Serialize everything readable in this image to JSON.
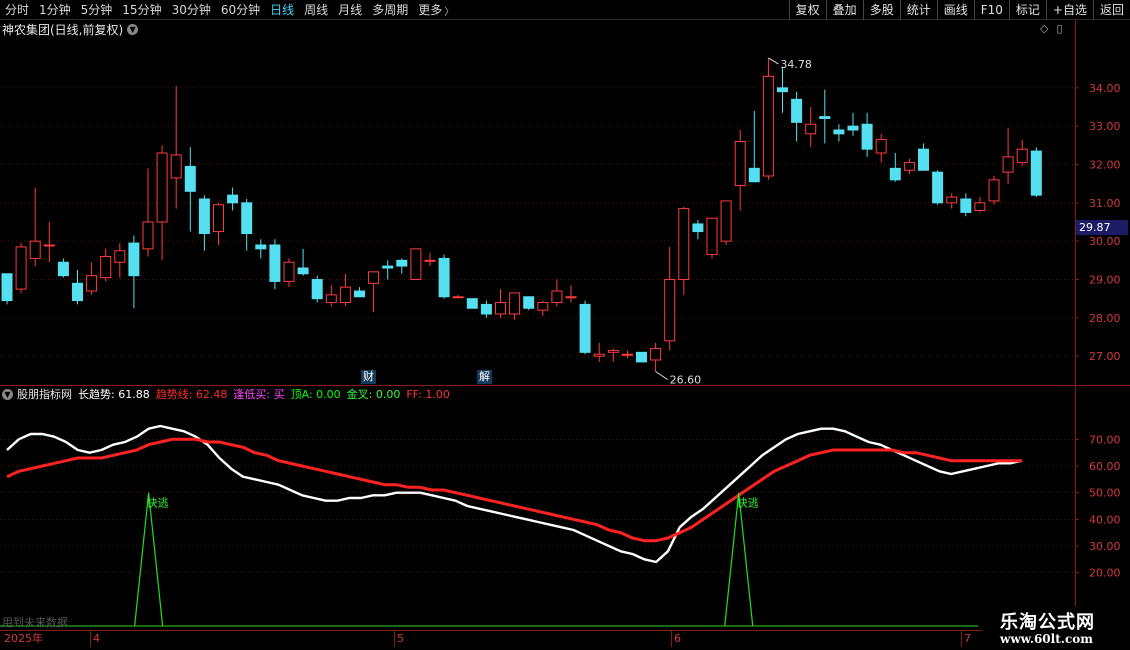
{
  "toolbar": {
    "periods": [
      {
        "label": "分时"
      },
      {
        "label": "1分钟"
      },
      {
        "label": "5分钟"
      },
      {
        "label": "15分钟"
      },
      {
        "label": "30分钟"
      },
      {
        "label": "60分钟"
      },
      {
        "label": "日线",
        "active": true
      },
      {
        "label": "周线"
      },
      {
        "label": "月线"
      },
      {
        "label": "多周期"
      },
      {
        "label": "更多"
      }
    ],
    "tools": [
      "复权",
      "叠加",
      "多股",
      "统计",
      "画线",
      "F10",
      "标记",
      "+自选",
      "返回"
    ]
  },
  "main_chart": {
    "title": "神农集团(日线,前复权)",
    "current_price": "29.87",
    "high_label": "34.78",
    "low_label": "26.60",
    "badges": [
      "财",
      "解"
    ]
  },
  "indicator": {
    "name": "股朋指标网",
    "items": [
      {
        "label": "长趋势: 61.88",
        "color": "#ffffff"
      },
      {
        "label": "趋势线: 62.48",
        "color": "#ff2a2a"
      },
      {
        "label": "逢低买: 买",
        "color": "#ff44ff"
      },
      {
        "label": "顶A: 0.00",
        "color": "#00ff00"
      },
      {
        "label": "金叉: 0.00",
        "color": "#33ff33"
      },
      {
        "label": "FF: 1.00",
        "color": "#ff3333"
      }
    ],
    "signal_label": "快逃",
    "future_note": "用到未来数据"
  },
  "timeline": [
    {
      "label": "2025年",
      "pos": 4
    },
    {
      "label": "4",
      "pos": 93
    },
    {
      "label": "5",
      "pos": 397
    },
    {
      "label": "6",
      "pos": 674
    },
    {
      "label": "7",
      "pos": 964
    }
  ],
  "watermark": {
    "title": "乐淘公式网",
    "url": "www.60lt.com"
  },
  "chart_data": [
    {
      "type": "candlestick",
      "title": "神农集团(日线,前复权)",
      "y_ticks": [
        27.0,
        28.0,
        29.0,
        30.0,
        31.0,
        32.0,
        33.0,
        34.0
      ],
      "ylim": [
        26.3,
        35.3
      ],
      "ohlc": [
        [
          29.15,
          29.15,
          28.35,
          28.45
        ],
        [
          28.75,
          29.95,
          28.65,
          29.85
        ],
        [
          29.55,
          31.4,
          29.35,
          30.0
        ],
        [
          29.9,
          30.5,
          29.45,
          29.9
        ],
        [
          29.45,
          29.55,
          29.05,
          29.1
        ],
        [
          28.9,
          29.25,
          28.35,
          28.45
        ],
        [
          28.7,
          29.45,
          28.6,
          29.1
        ],
        [
          29.05,
          29.8,
          28.95,
          29.6
        ],
        [
          29.45,
          29.95,
          29.05,
          29.75
        ],
        [
          29.95,
          30.15,
          28.25,
          29.1
        ],
        [
          29.8,
          31.9,
          29.6,
          30.5
        ],
        [
          30.5,
          32.5,
          29.5,
          32.3
        ],
        [
          31.65,
          34.05,
          30.85,
          32.25
        ],
        [
          31.95,
          32.45,
          30.25,
          31.3
        ],
        [
          31.1,
          31.2,
          29.75,
          30.2
        ],
        [
          30.25,
          31.0,
          29.9,
          30.95
        ],
        [
          31.2,
          31.4,
          30.8,
          31.0
        ],
        [
          31.0,
          31.1,
          29.75,
          30.2
        ],
        [
          29.9,
          30.05,
          29.55,
          29.8
        ],
        [
          29.9,
          30.05,
          28.75,
          28.95
        ],
        [
          28.95,
          29.55,
          28.8,
          29.45
        ],
        [
          29.3,
          29.8,
          29.1,
          29.15
        ],
        [
          29.0,
          29.1,
          28.4,
          28.5
        ],
        [
          28.4,
          28.85,
          28.3,
          28.6
        ],
        [
          28.4,
          29.15,
          28.3,
          28.8
        ],
        [
          28.7,
          28.8,
          28.55,
          28.55
        ],
        [
          28.9,
          29.15,
          28.15,
          29.2
        ],
        [
          29.35,
          29.5,
          29.0,
          29.3
        ],
        [
          29.5,
          29.55,
          29.15,
          29.35
        ],
        [
          29.0,
          29.8,
          29.05,
          29.8
        ],
        [
          29.5,
          29.7,
          29.35,
          29.5
        ],
        [
          29.55,
          29.65,
          28.5,
          28.55
        ],
        [
          28.55,
          28.6,
          28.55,
          28.55
        ],
        [
          28.5,
          28.5,
          28.25,
          28.25
        ],
        [
          28.35,
          28.45,
          28.0,
          28.1
        ],
        [
          28.1,
          28.75,
          28.0,
          28.4
        ],
        [
          28.1,
          28.6,
          27.95,
          28.65
        ],
        [
          28.55,
          28.55,
          28.2,
          28.25
        ],
        [
          28.2,
          28.45,
          28.05,
          28.4
        ],
        [
          28.4,
          29.0,
          28.3,
          28.7
        ],
        [
          28.55,
          28.85,
          28.4,
          28.55
        ],
        [
          28.35,
          28.45,
          27.05,
          27.1
        ],
        [
          27.0,
          27.35,
          26.85,
          27.05
        ],
        [
          27.1,
          27.2,
          26.85,
          27.15
        ],
        [
          27.05,
          27.15,
          26.95,
          27.05
        ],
        [
          27.1,
          27.1,
          26.85,
          26.85
        ],
        [
          26.9,
          27.35,
          26.6,
          27.2
        ],
        [
          27.4,
          29.85,
          27.15,
          29.0
        ],
        [
          29.0,
          30.9,
          28.6,
          30.85
        ],
        [
          30.45,
          30.55,
          30.05,
          30.25
        ],
        [
          29.65,
          30.2,
          29.55,
          30.6
        ],
        [
          30.0,
          31.05,
          29.9,
          31.05
        ],
        [
          31.45,
          32.9,
          30.8,
          32.6
        ],
        [
          31.9,
          33.4,
          31.65,
          31.55
        ],
        [
          31.7,
          34.78,
          31.6,
          34.3
        ],
        [
          34.0,
          34.55,
          33.35,
          33.9
        ],
        [
          33.7,
          33.9,
          32.6,
          33.1
        ],
        [
          32.8,
          33.5,
          32.45,
          33.05
        ],
        [
          33.25,
          33.95,
          32.55,
          33.2
        ],
        [
          32.9,
          33.05,
          32.6,
          32.8
        ],
        [
          33.0,
          33.35,
          32.75,
          32.9
        ],
        [
          33.05,
          33.35,
          32.2,
          32.4
        ],
        [
          32.3,
          32.8,
          32.05,
          32.65
        ],
        [
          31.9,
          32.3,
          31.55,
          31.6
        ],
        [
          31.85,
          32.15,
          31.75,
          32.05
        ],
        [
          32.4,
          32.55,
          31.9,
          31.85
        ],
        [
          31.8,
          31.85,
          30.95,
          31.0
        ],
        [
          31.0,
          31.25,
          30.85,
          31.15
        ],
        [
          31.1,
          31.25,
          30.65,
          30.75
        ],
        [
          30.8,
          31.15,
          30.75,
          31.0
        ],
        [
          31.05,
          31.7,
          30.95,
          31.6
        ],
        [
          31.8,
          32.95,
          31.5,
          32.2
        ],
        [
          32.05,
          32.65,
          31.95,
          32.4
        ],
        [
          32.35,
          32.45,
          31.15,
          31.2
        ]
      ]
    },
    {
      "type": "line",
      "y_ticks": [
        20.0,
        30.0,
        40.0,
        50.0,
        60.0,
        70.0
      ],
      "ylim": [
        0,
        84
      ],
      "series": [
        {
          "name": "长趋势",
          "color": "#ffffff",
          "values": [
            66,
            70,
            72,
            72,
            71,
            69,
            66,
            65,
            66,
            68,
            69,
            71,
            74,
            75,
            74,
            73,
            71,
            68,
            63,
            59,
            56,
            55,
            54,
            53,
            51,
            49,
            48,
            47,
            47,
            48,
            48,
            49,
            49,
            50,
            50,
            50,
            49,
            48,
            47,
            45,
            44,
            43,
            42,
            41,
            40,
            39,
            38,
            37,
            36,
            34,
            32,
            30,
            28,
            27,
            25,
            24,
            28,
            37,
            41,
            44,
            48,
            52,
            56,
            60,
            64,
            67,
            70,
            72,
            73,
            74,
            74,
            73,
            71,
            69,
            68,
            66,
            64,
            62,
            60,
            58,
            57,
            58,
            59,
            60,
            61,
            61,
            62
          ]
        },
        {
          "name": "趋势线",
          "color": "#ff2222",
          "values": [
            56,
            58,
            59,
            60,
            61,
            62,
            63,
            63,
            63,
            64,
            65,
            66,
            68,
            69,
            70,
            70,
            70,
            69,
            69,
            68,
            67,
            65,
            64,
            62,
            61,
            60,
            59,
            58,
            57,
            56,
            55,
            54,
            53,
            53,
            52,
            52,
            51,
            51,
            50,
            49,
            48,
            47,
            46,
            45,
            44,
            43,
            42,
            41,
            40,
            39,
            38,
            36,
            35,
            33,
            32,
            32,
            33,
            35,
            37,
            40,
            43,
            46,
            49,
            52,
            55,
            58,
            60,
            62,
            64,
            65,
            66,
            66,
            66,
            66,
            66,
            66,
            65,
            65,
            64,
            63,
            62,
            62,
            62,
            62,
            62,
            62,
            62
          ]
        },
        {
          "name": "快逃",
          "color": "#22dd22",
          "values": [
            0,
            0,
            0,
            0,
            0,
            0,
            0,
            0,
            0,
            0,
            0,
            0,
            50,
            0,
            0,
            0,
            0,
            0,
            0,
            0,
            0,
            0,
            0,
            0,
            0,
            0,
            0,
            0,
            0,
            0,
            0,
            0,
            0,
            0,
            0,
            0,
            0,
            0,
            0,
            0,
            0,
            0,
            0,
            0,
            0,
            0,
            0,
            0,
            0,
            0,
            0,
            0,
            0,
            0,
            0,
            0,
            0,
            0,
            0,
            0,
            0,
            0,
            50,
            0,
            0,
            0,
            0,
            0,
            0,
            0,
            0,
            0,
            0,
            0,
            0,
            0,
            0,
            0,
            0,
            0,
            0,
            0,
            0,
            0,
            0,
            0,
            0
          ]
        }
      ]
    }
  ]
}
